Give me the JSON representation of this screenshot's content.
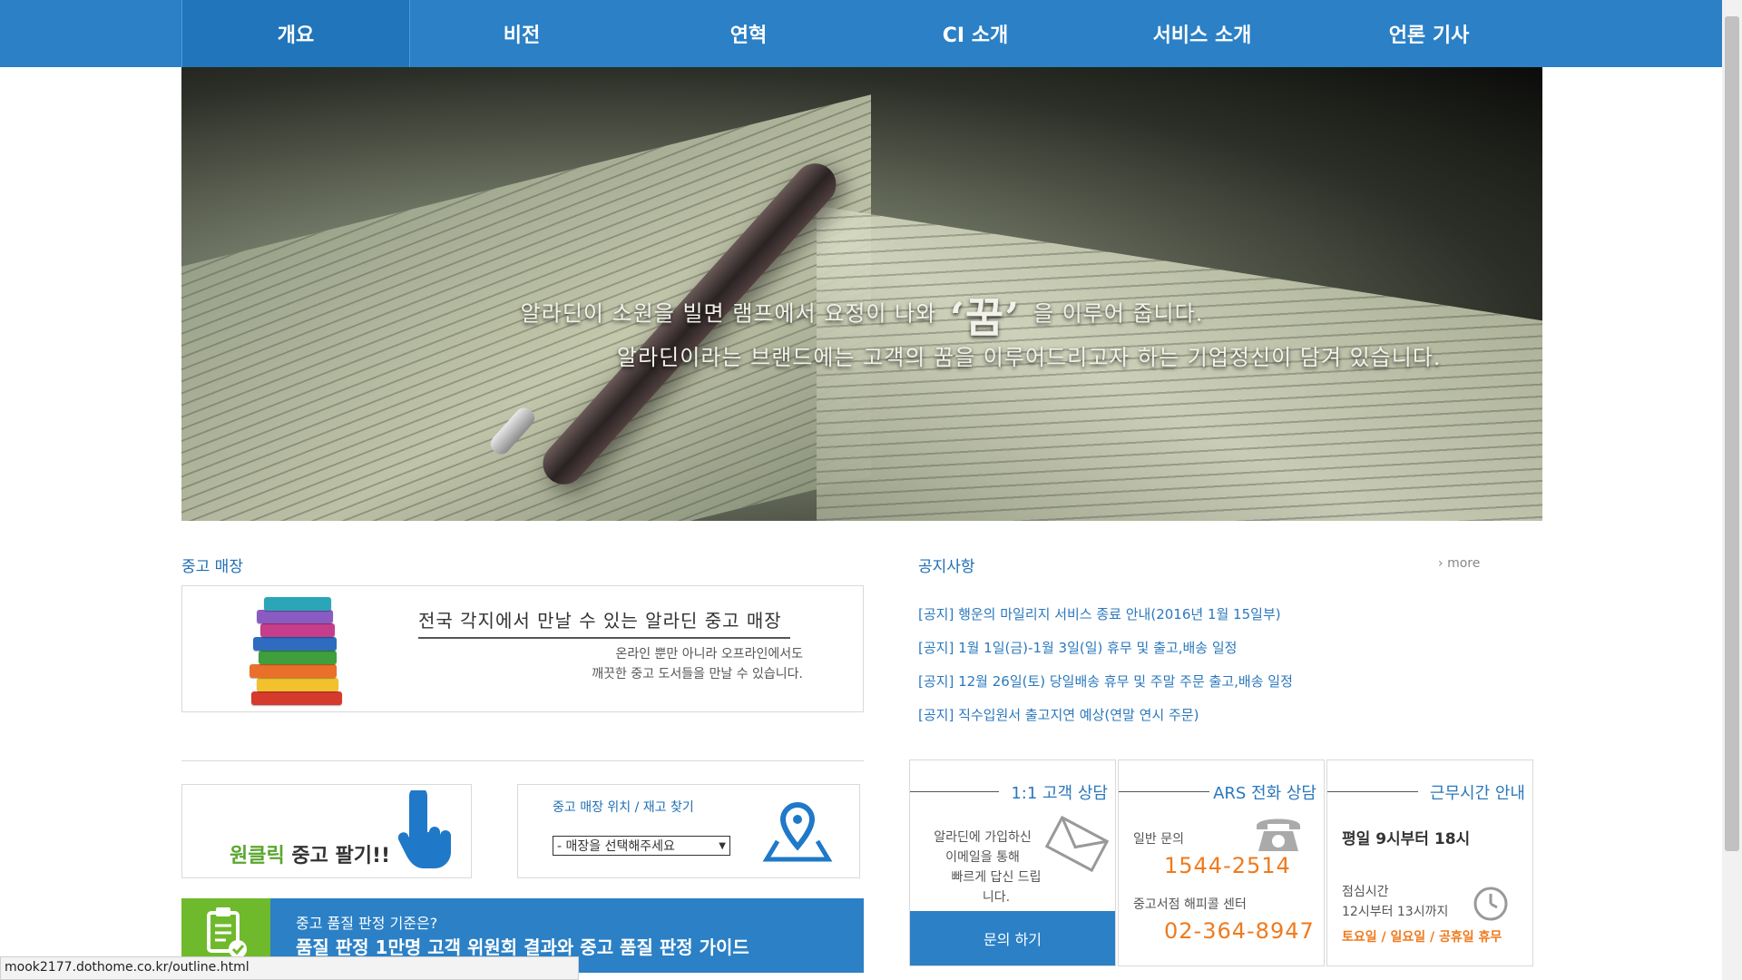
{
  "nav": {
    "items": [
      {
        "label": "개요"
      },
      {
        "label": "비전"
      },
      {
        "label": "연혁"
      },
      {
        "label": "CI 소개"
      },
      {
        "label": "서비스 소개"
      },
      {
        "label": "언론 기사"
      }
    ]
  },
  "hero": {
    "line1_before": "알라딘이 소원을 빌면 램프에서 요정이 나와",
    "line1_dream": "‘꿈’",
    "line1_after": "을 이루어 줍니다.",
    "line2": "알라딘이라는 브랜드에는 고객의 꿈을 이루어드리고자 하는 기업정신이 담겨 있습니다."
  },
  "used_store": {
    "title": "중고 매장",
    "headline": "전국 각지에서 만날 수 있는 알라딘 중고 매장",
    "sub1": "온라인 뿐만 아니라 오프라인에서도",
    "sub2": "깨끗한 중고 도서들을 만날 수 있습니다."
  },
  "sell": {
    "highlight": "원클릭",
    "rest": " 중고 팔기!!"
  },
  "find": {
    "label": "중고 매장 위치 / 재고 찾기",
    "selected": "- 매장을 선택해주세요"
  },
  "quality": {
    "line1": "중고 품질 판정 기준은?",
    "line2": "품질 판정 1만명 고객 위원회 결과와 중고 품질 판정 가이드"
  },
  "notices": {
    "title": "공지사항",
    "more": "more",
    "items": [
      "[공지] 행운의 마일리지 서비스 종료 안내(2016년 1월 15일부)",
      "[공지] 1월 1일(금)-1월 3일(일) 휴무 및 출고,배송 일정",
      "[공지] 12월 26일(토) 당일배송 휴무 및 주말 주문 출고,배송 일정",
      "[공지] 직수입원서 출고지연 예상(연말 연시 주문)"
    ]
  },
  "support": {
    "consult": {
      "title": "1:1 고객 상담",
      "line1": "알라딘에 가입하신",
      "line2": "이메일을 통해",
      "line3": "빠르게 답신 드립니다.",
      "button": "문의 하기"
    },
    "ars": {
      "title": "ARS 전화 상담",
      "general_label": "일반 문의",
      "general_number": "1544-2514",
      "used_label": "중고서점 해피콜 센터",
      "used_number": "02-364-8947"
    },
    "hours": {
      "title": "근무시간 안내",
      "weekday": "평일  9시부터 18시",
      "lunch_label": "점심시간",
      "lunch_time": "12시부터 13시까지",
      "closed": "토요일 / 일요일 / 공휴일 휴무"
    }
  },
  "statusbar": {
    "url": "mook2177.dothome.co.kr/outline.html"
  },
  "colors": {
    "primary": "#2b80c6",
    "accent_orange": "#f07a1d",
    "accent_green": "#6fba2c"
  }
}
